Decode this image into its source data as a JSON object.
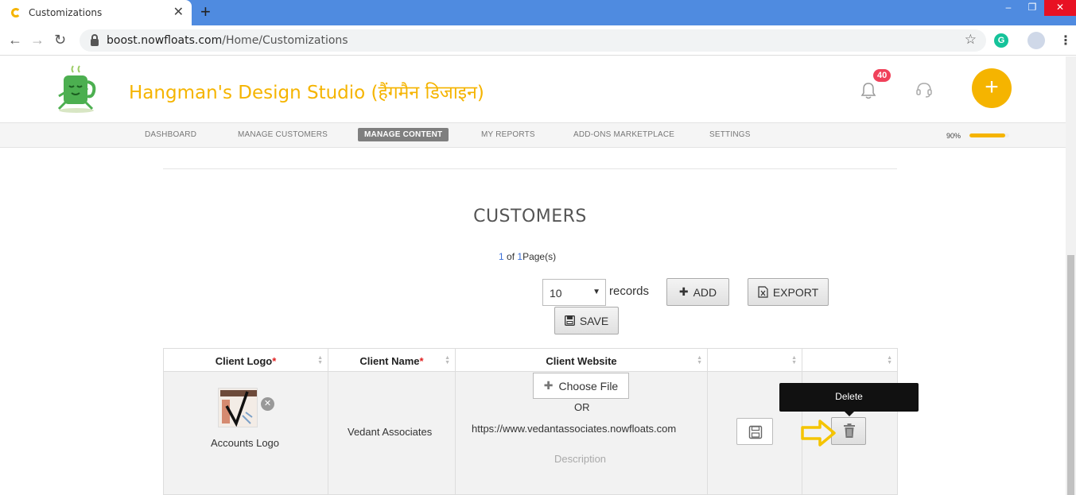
{
  "browser": {
    "tab_title": "Customizations",
    "tab_close": "✕",
    "new_tab": "+",
    "url_domain": "boost.nowfloats.com",
    "url_path": "/Home/Customizations",
    "ext_letter": "G",
    "win_min": "–",
    "win_restore": "❐",
    "win_close": "✕"
  },
  "header": {
    "brand": "Hangman's Design Studio (हैंगमैन डिजाइन)",
    "notification_count": "40",
    "fab_label": "+",
    "accent_color": "#f5b400"
  },
  "nav": {
    "items": [
      {
        "label": "DASHBOARD",
        "active": false
      },
      {
        "label": "MANAGE CUSTOMERS",
        "active": false
      },
      {
        "label": "MANAGE CONTENT",
        "active": true
      },
      {
        "label": "MY REPORTS",
        "active": false
      },
      {
        "label": "ADD-ONS MARKETPLACE",
        "active": false
      },
      {
        "label": "SETTINGS",
        "active": false
      }
    ],
    "progress_label": "90%",
    "progress_value": 0.9
  },
  "main": {
    "title": "CUSTOMERS",
    "pager": {
      "current": "1",
      "of": "of",
      "total": "1",
      "suffix": "Page(s)"
    },
    "records_value": "10",
    "records_label": "records",
    "add_label": "ADD",
    "export_label": "EXPORT",
    "save_label": "SAVE"
  },
  "table": {
    "columns": [
      {
        "label": "Client Logo",
        "required": true
      },
      {
        "label": "Client Name",
        "required": true
      },
      {
        "label": "Client Website",
        "required": false
      },
      {
        "label": "",
        "required": false
      },
      {
        "label": "",
        "required": false
      }
    ],
    "required_mark": "*",
    "row": {
      "logo_caption": "Accounts Logo",
      "client_name": "Vedant Associates",
      "choose_file_label": "Choose File",
      "or_label": "OR",
      "website": "https://www.vedantassociates.nowfloats.com",
      "description_placeholder": "Description"
    }
  },
  "tooltip": {
    "text": "Delete"
  }
}
